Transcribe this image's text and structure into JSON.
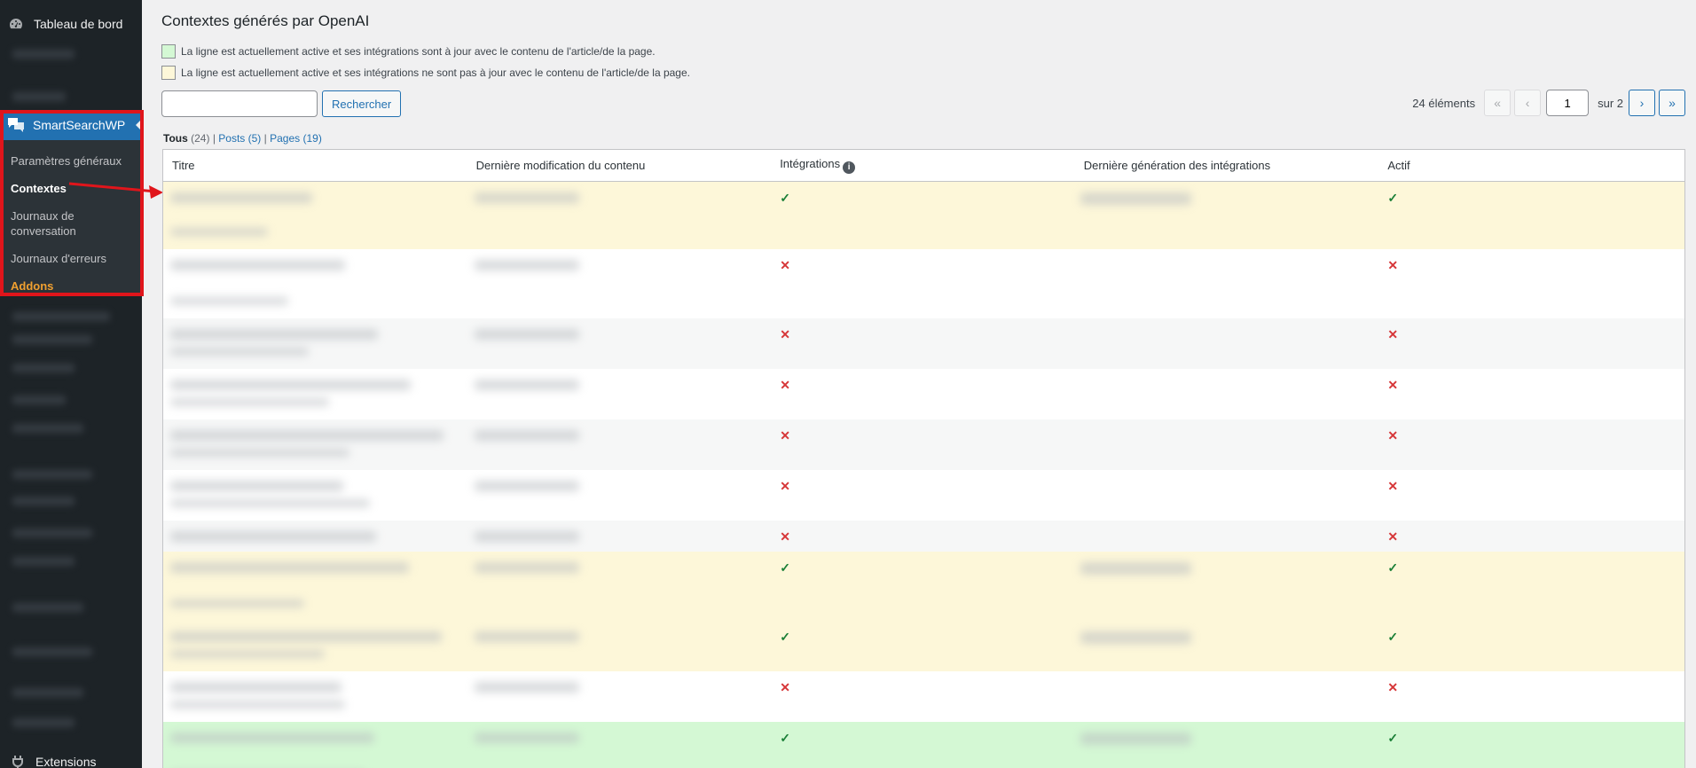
{
  "sidebar": {
    "dashboard_label": "Tableau de bord",
    "plugin_label": "SmartSearchWP",
    "submenu": [
      {
        "label": "Paramètres généraux"
      },
      {
        "label": "Contextes"
      },
      {
        "label": "Journaux de conversation"
      },
      {
        "label": "Journaux d'erreurs"
      },
      {
        "label": "Addons"
      }
    ],
    "extensions_label": "Extensions"
  },
  "main": {
    "title": "Contextes générés par OpenAI",
    "legend_green": "La ligne est actuellement active et ses intégrations sont à jour avec le contenu de l'article/de la page.",
    "legend_yellow": "La ligne est actuellement active et ses intégrations ne sont pas à jour avec le contenu de l'article/de la page.",
    "search_value": "",
    "search_button": "Rechercher",
    "pager": {
      "count": "24 éléments",
      "first": "«",
      "prev": "‹",
      "current_page": "1",
      "of_label": "sur 2",
      "next": "›",
      "last": "»"
    },
    "filters": {
      "all_label": "Tous",
      "all_count": "(24)",
      "posts_label": "Posts",
      "posts_count": "(5)",
      "pages_label": "Pages",
      "pages_count": "(19)",
      "separator": "|"
    },
    "table": {
      "headers": {
        "title": "Titre",
        "modified": "Dernière modification du contenu",
        "embeddings": "Intégrations",
        "generated": "Dernière génération des intégrations",
        "active": "Actif"
      },
      "rows": [
        {
          "status": "yellow",
          "embeddings": "✓",
          "active": "✓"
        },
        {
          "status": "white",
          "embeddings": "✕",
          "active": "✕"
        },
        {
          "status": "alt",
          "embeddings": "✕",
          "active": "✕"
        },
        {
          "status": "white",
          "embeddings": "✕",
          "active": "✕"
        },
        {
          "status": "alt",
          "embeddings": "✕",
          "active": "✕"
        },
        {
          "status": "white",
          "embeddings": "✕",
          "active": "✕"
        },
        {
          "status": "alt",
          "embeddings": "✕",
          "active": "✕"
        },
        {
          "status": "yellow",
          "embeddings": "✓",
          "active": "✓"
        },
        {
          "status": "yellow",
          "embeddings": "✓",
          "active": "✓"
        },
        {
          "status": "white",
          "embeddings": "✕",
          "active": "✕"
        },
        {
          "status": "green",
          "embeddings": "✓",
          "active": "✓"
        }
      ]
    }
  },
  "colors": {
    "sidebar_bg": "#1d2327",
    "accent": "#2271b1",
    "row_outdated": "#fdf7d9",
    "row_uptodate": "#d4f8d4",
    "check": "#1a7f37",
    "cross": "#d63638",
    "annotation": "#e0151b"
  },
  "icons": {
    "dashboard": "dashboard-icon",
    "plugin": "chat-bubbles-icon",
    "extensions": "plugin-icon",
    "info": "info-icon"
  }
}
